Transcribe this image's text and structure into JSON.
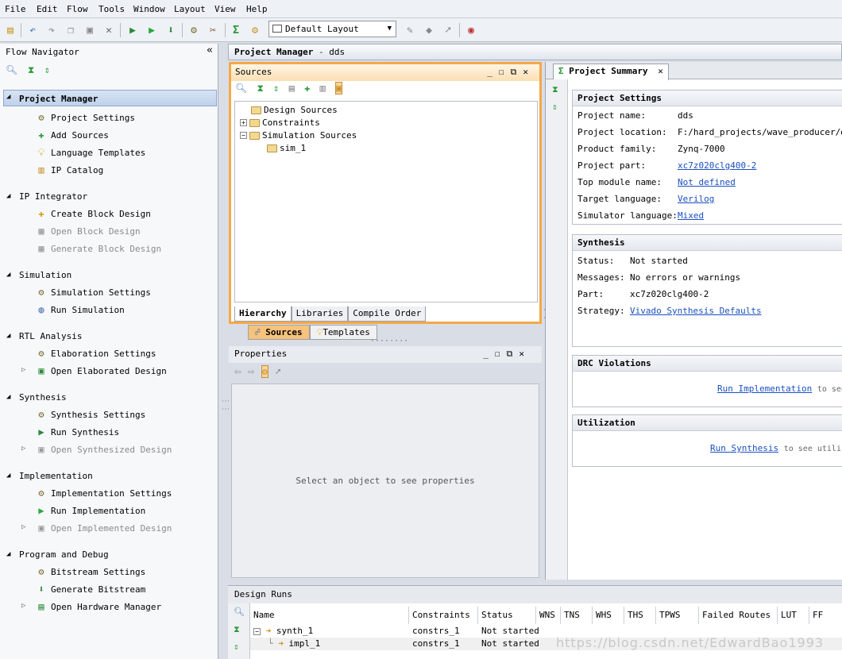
{
  "menu": [
    "File",
    "Edit",
    "Flow",
    "Tools",
    "Window",
    "Layout",
    "View",
    "Help"
  ],
  "toolbar": {
    "layout_value": "Default Layout"
  },
  "flow_navigator": {
    "title": "Flow Navigator",
    "sections": [
      {
        "label": "Project Manager",
        "items": [
          {
            "label": "Project Settings",
            "icon": "gear-icon"
          },
          {
            "label": "Add Sources",
            "icon": "add-sources-icon"
          },
          {
            "label": "Language Templates",
            "icon": "lightbulb-icon"
          },
          {
            "label": "IP Catalog",
            "icon": "ip-catalog-icon"
          }
        ]
      },
      {
        "label": "IP Integrator",
        "items": [
          {
            "label": "Create Block Design",
            "icon": "block-design-icon"
          },
          {
            "label": "Open Block Design",
            "icon": "block-design-icon"
          },
          {
            "label": "Generate Block Design",
            "icon": "block-design-icon"
          }
        ]
      },
      {
        "label": "Simulation",
        "items": [
          {
            "label": "Simulation Settings",
            "icon": "gear-icon"
          },
          {
            "label": "Run Simulation",
            "icon": "simulation-icon"
          }
        ]
      },
      {
        "label": "RTL Analysis",
        "items": [
          {
            "label": "Elaboration Settings",
            "icon": "gear-icon"
          },
          {
            "label": "Open Elaborated Design",
            "icon": "design-icon"
          }
        ]
      },
      {
        "label": "Synthesis",
        "items": [
          {
            "label": "Synthesis Settings",
            "icon": "gear-icon"
          },
          {
            "label": "Run Synthesis",
            "icon": "run-icon"
          },
          {
            "label": "Open Synthesized Design",
            "icon": "design-icon"
          }
        ]
      },
      {
        "label": "Implementation",
        "items": [
          {
            "label": "Implementation Settings",
            "icon": "gear-icon"
          },
          {
            "label": "Run Implementation",
            "icon": "run-icon"
          },
          {
            "label": "Open Implemented Design",
            "icon": "design-icon"
          }
        ]
      },
      {
        "label": "Program and Debug",
        "items": [
          {
            "label": "Bitstream Settings",
            "icon": "gear-icon"
          },
          {
            "label": "Generate Bitstream",
            "icon": "bitstream-icon"
          },
          {
            "label": "Open Hardware Manager",
            "icon": "hardware-icon"
          }
        ]
      }
    ]
  },
  "pm_header": {
    "title": "Project Manager",
    "sep": "-",
    "project": "dds"
  },
  "sources": {
    "title": "Sources",
    "tree": [
      "Design Sources",
      "Constraints",
      "Simulation Sources",
      "sim_1"
    ],
    "tabs": [
      "Hierarchy",
      "Libraries",
      "Compile Order"
    ],
    "bottom_tabs": [
      "Sources",
      "Templates"
    ]
  },
  "properties": {
    "title": "Properties",
    "placeholder": "Select an object to see properties"
  },
  "summary": {
    "tab": "Project Summary",
    "settings_title": "Project Settings",
    "settings": [
      {
        "k": "Project name:",
        "v": "dds"
      },
      {
        "k": "Project location:",
        "v": "F:/hard_projects/wave_producer/dds"
      },
      {
        "k": "Product family:",
        "v": "Zynq-7000"
      },
      {
        "k": "Project part:",
        "v": "xc7z020clg400-2"
      },
      {
        "k": "Top module name:",
        "v": "Not defined"
      },
      {
        "k": "Target language:",
        "v": "Verilog"
      },
      {
        "k": "Simulator language:",
        "v": "Mixed"
      }
    ],
    "synth_title": "Synthesis",
    "synth": [
      {
        "k": "Status:",
        "v": "Not started"
      },
      {
        "k": "Messages:",
        "v": "No errors or warnings"
      },
      {
        "k": "Part:",
        "v": "xc7z020clg400-2"
      },
      {
        "k": "Strategy:",
        "v": "Vivado Synthesis Defaults"
      }
    ],
    "drc_title": "DRC Violations",
    "drc_link": "Run Implementation",
    "drc_text": "to see D",
    "util_title": "Utilization",
    "util_link": "Run Synthesis",
    "util_text": "to see utiliza"
  },
  "design_runs": {
    "title": "Design Runs",
    "columns": [
      "Name",
      "Constraints",
      "Status",
      "WNS",
      "TNS",
      "WHS",
      "THS",
      "TPWS",
      "Failed Routes",
      "LUT",
      "FF"
    ],
    "rows": [
      {
        "name": "synth_1",
        "constraints": "constrs_1",
        "status": "Not started"
      },
      {
        "name": "impl_1",
        "constraints": "constrs_1",
        "status": "Not started"
      }
    ]
  },
  "watermark": "https://blog.csdn.net/EdwardBao1993",
  "colors": {
    "accent": "#f5a84a",
    "link": "#1a4fc0",
    "selection": "#bfd1ea"
  }
}
